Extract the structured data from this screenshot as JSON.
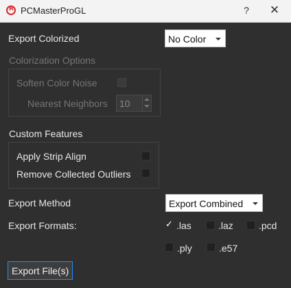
{
  "window": {
    "title": "PCMasterProGL",
    "help_label": "?",
    "close_label": "✕"
  },
  "export_colorized": {
    "label": "Export Colorized",
    "value": "No Color"
  },
  "colorization_options": {
    "label": "Colorization Options",
    "soften_label": "Soften Color Noise",
    "neighbors_label": "Nearest Neighbors",
    "neighbors_value": "10"
  },
  "custom_features": {
    "label": "Custom Features",
    "strip_align_label": "Apply Strip Align",
    "outliers_label": "Remove Collected Outliers"
  },
  "export_method": {
    "label": "Export Method",
    "value": "Export Combined"
  },
  "export_formats": {
    "label": "Export Formats:",
    "check_symbol": "✓",
    "las": ".las",
    "laz": ".laz",
    "pcd": ".pcd",
    "ply": ".ply",
    "e57": ".e57"
  },
  "export_button": {
    "label": "Export File(s)"
  },
  "colors": {
    "accent": "#1e90ff",
    "brand": "#d9252a",
    "background": "#2f2f2f"
  }
}
